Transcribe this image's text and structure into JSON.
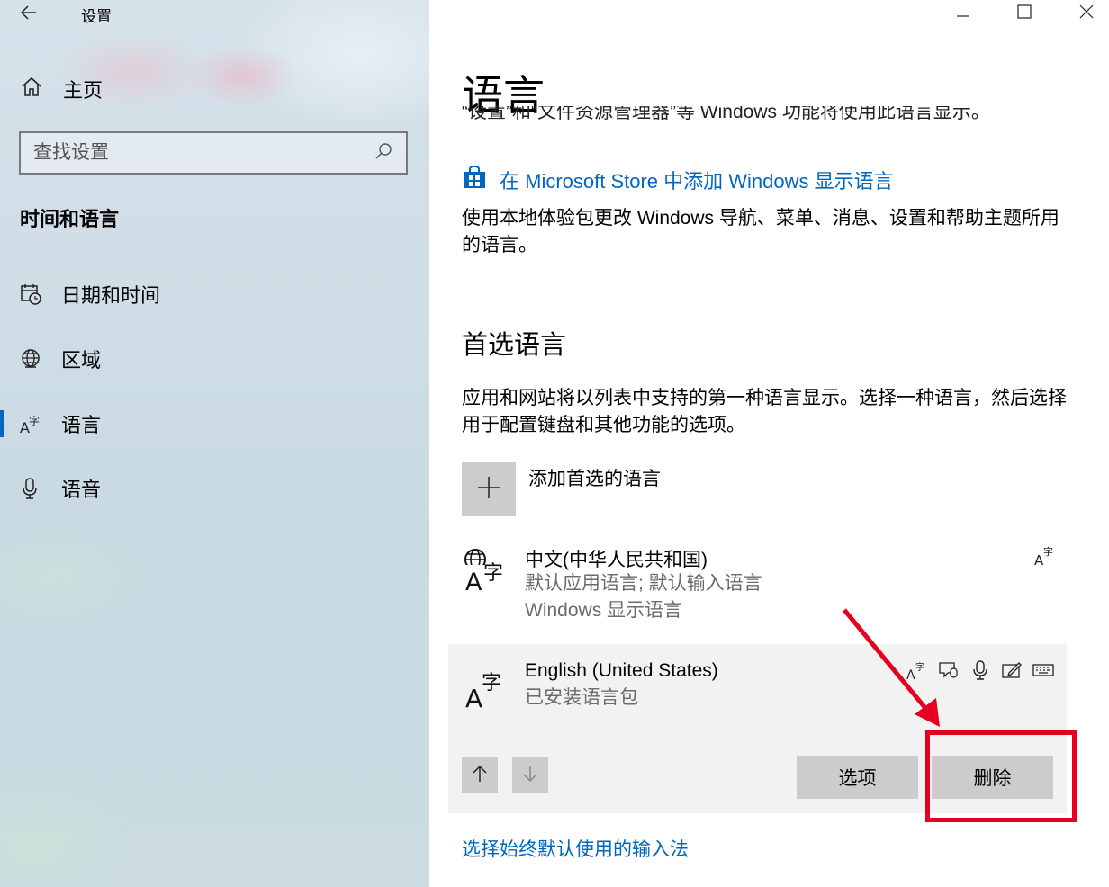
{
  "window": {
    "app_title": "设置"
  },
  "sidebar": {
    "home_label": "主页",
    "search_placeholder": "查找设置",
    "section_title": "时间和语言",
    "items": [
      {
        "label": "日期和时间",
        "icon": "calendar-clock-icon"
      },
      {
        "label": "区域",
        "icon": "globe-icon"
      },
      {
        "label": "语言",
        "icon": "language-icon",
        "selected": true
      },
      {
        "label": "语音",
        "icon": "microphone-icon"
      }
    ],
    "accent_color": "#0067c0"
  },
  "main": {
    "title": "语言",
    "cut_text": "“设置”和“文件资源管理器”等 Windows 功能将使用此语言显示。",
    "store_link": "在 Microsoft Store 中添加 Windows 显示语言",
    "store_desc": "使用本地体验包更改 Windows 导航、菜单、消息、设置和帮助主题所用的语言。",
    "preferred_heading": "首选语言",
    "preferred_desc": "应用和网站将以列表中支持的第一种语言显示。选择一种语言，然后选择用于配置键盘和其他功能的选项。",
    "add_language_label": "添加首选的语言",
    "languages": [
      {
        "name": "中文(中华人民共和国)",
        "sub1": "默认应用语言; 默认输入语言",
        "sub2": "Windows 显示语言",
        "features": [
          "display-language-icon"
        ]
      },
      {
        "name": "English (United States)",
        "sub1": "已安装语言包",
        "features": [
          "display-language-icon",
          "text-to-speech-icon",
          "speech-recognition-icon",
          "handwriting-icon",
          "keyboard-icon"
        ]
      }
    ],
    "options_button": "选项",
    "remove_button": "删除",
    "input_method_link": "选择始终默认使用的输入法"
  },
  "annotation_color": "#e5001f"
}
